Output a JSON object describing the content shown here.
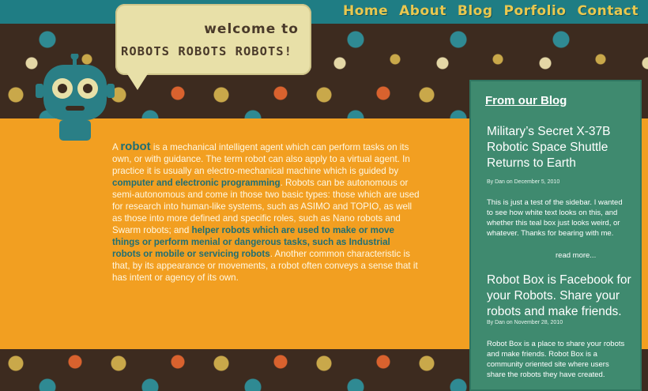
{
  "nav": {
    "home": "Home",
    "about": "About",
    "blog": "Blog",
    "portfolio": "Porfolio",
    "contact": "Contact"
  },
  "banner": {
    "line1": "welcome to",
    "line2": "ROBOTS ROBOTS ROBOTS!"
  },
  "intro": {
    "a": "A ",
    "robot": "robot",
    "p1": " is a mechanical intelligent agent which can perform tasks on its own, or with guidance. The term robot can also apply to a virtual agent. In practice it is usually an electro-mechanical machine which is guided by ",
    "link1": "computer and electronic programming",
    "p2": ". Robots can be autonomous or semi-autonomous and come in those two basic types: those which are used for research into human-like systems, such as ASIMO and TOPIO, as well as those into more defined and specific roles, such as Nano robots and Swarm robots; and ",
    "link2": "helper robots which are used to make or move things or perform menial or dangerous tasks, such as Industrial robots or mobile or servicing robots",
    "p3": ". Another common characteristic is that, by its appearance or movements, a robot often conveys a sense that it has intent or agency of its own."
  },
  "sidebar": {
    "heading": "From our Blog",
    "posts": [
      {
        "title": "Military’s Secret X-37B Robotic Space Shuttle Returns to Earth",
        "date": "By Dan on December 5, 2010",
        "body": "This is just a test of the sidebar. I wanted to see how white text looks on this, and whether this teal box just looks weird, or whatever. Thanks for bearing with me.",
        "more": "read more..."
      },
      {
        "title": "Robot Box is Facebook for your Robots. Share your robots and make friends.",
        "date": "By Dan on November 28, 2010",
        "body": "Robot Box is a place to share your robots and make friends. Robot Box is a community oriented site where users share the robots they have created."
      }
    ]
  },
  "colors": {
    "nav": "#e9c84f",
    "topbar": "#1f7d84",
    "content": "#f29f21",
    "sidebar": "#3f8a6f",
    "keyword": "#1f6f74"
  }
}
